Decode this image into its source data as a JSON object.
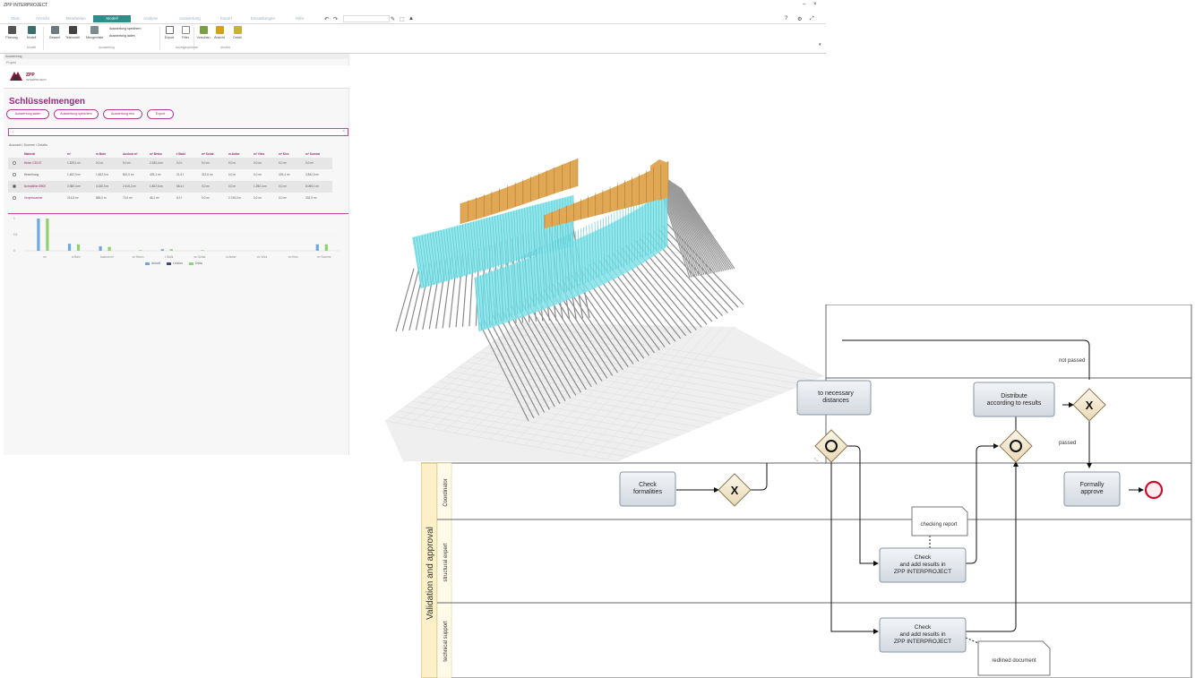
{
  "app": {
    "title": "ZPP INTERPROJECT",
    "window_controls": {
      "minimize": "–",
      "close": "×"
    },
    "tabs": [
      {
        "label": "Start",
        "active": false
      },
      {
        "label": "Ansicht",
        "active": false
      },
      {
        "label": "Bearbeiten",
        "active": false
      },
      {
        "label": "Modell",
        "active": true
      },
      {
        "label": "Analyse",
        "active": false
      },
      {
        "label": "Auswertung",
        "active": false
      },
      {
        "label": "Export",
        "active": false
      },
      {
        "label": "Einstellungen",
        "active": false
      },
      {
        "label": "Hilfe",
        "active": false
      }
    ],
    "ribbon": {
      "buttons": [
        {
          "label": "Planung",
          "color": "#555555"
        },
        {
          "label": "Modell",
          "color": "#3a6f6c"
        },
        {
          "label": "Gesamt",
          "color": "#6b7a7f"
        },
        {
          "label": "Teilmodell",
          "color": "#444444"
        },
        {
          "label": "Mengenliste",
          "color": "#7a8a8f"
        },
        {
          "label": "Export",
          "color": "#6c6c6c"
        },
        {
          "label": "Filter",
          "color": "#888888"
        },
        {
          "label": "Vorschau",
          "color": "#7aa046"
        },
        {
          "label": "Ansicht",
          "color": "#d4a117"
        },
        {
          "label": "Detail",
          "color": "#c9b23a"
        }
      ],
      "wide_items": [
        "Auswertung speichern",
        "Auswertung laden"
      ],
      "groups": [
        "Modell",
        "Auswertung",
        "Anzeigeoptionen",
        "Ansicht"
      ]
    },
    "panel": {
      "header": "Auswertung",
      "crumb": "Projekt",
      "logo_text": "ZPP",
      "logo_sub": "INTERPROJECT",
      "title": "Schlüsselmengen",
      "pills": [
        "Auswertung laden",
        "Auswertung speichern",
        "Auswertung neu",
        "Export"
      ],
      "filter_value": "",
      "table_caption": "Auswahl / Summe / Details",
      "table": {
        "headers": [
          "Material",
          "m³",
          "m Bohr",
          "Aushub m³",
          "m³ Beton",
          "t Stahl",
          "m² Schal.",
          "m Anker",
          "m² Vlies",
          "m³ Kies",
          "m³ Summe"
        ],
        "rows": [
          {
            "checked": false,
            "cells": [
              "Beton C30/37",
              "1.325,1 m³",
              "0,0 m",
              "0,0 m³",
              "2.180,4 m³",
              "0,0 t",
              "0,0 m²",
              "0,0 m",
              "0,0 m²",
              "0,0 m³",
              "0,0 m³"
            ]
          },
          {
            "checked": false,
            "cells": [
              "Bewehrung",
              "1.482,0 m³",
              "1.842,0 m",
              "842,0 m³",
              "425,1 m³",
              "21,3 t",
              "312,6 m²",
              "0,0 m",
              "0,0 m²",
              "325,4 m³",
              "3.842,6 m³"
            ]
          },
          {
            "checked": true,
            "cells": [
              "Bohrpfähle Ø900",
              "2.380,4 m³",
              "4.150,0 m",
              "2.416,2 m³",
              "1.822,5 m³",
              "65,4 t",
              "0,0 m²",
              "0,0 m",
              "1.250,4 m²",
              "0,0 m³",
              "8.065,1 m³"
            ]
          },
          {
            "checked": false,
            "cells": [
              "Verpressanker",
              "214,8 m³",
              "865,0 m",
              "72,0 m³",
              "46,1 m³",
              "8,2 t",
              "0,0 m²",
              "2.745,0 m",
              "0,0 m²",
              "0,0 m³",
              "332,9 m³"
            ]
          }
        ]
      },
      "chart_data": {
        "type": "bar",
        "categories": [
          "m³",
          "m Bohr",
          "Aushub m³",
          "m³ Beton",
          "t Stahl",
          "m² Schal.",
          "m Anker",
          "m² Vlies",
          "m³ Kies",
          "m³ Summe"
        ],
        "series": [
          {
            "name": "Aktuell",
            "color": "#6aa8e6",
            "values": [
              1.0,
              0.22,
              0.14,
              0.0,
              0.05,
              0.0,
              0.0,
              0.0,
              0.0,
              0.2
            ]
          },
          {
            "name": "Letztes",
            "color": "#3a4a7a",
            "values": [
              0.0,
              0.0,
              0.0,
              0.0,
              0.0,
              0.0,
              0.0,
              0.0,
              0.0,
              0.0
            ]
          },
          {
            "name": "Delta",
            "color": "#8bd36a",
            "values": [
              1.0,
              0.2,
              0.12,
              0.02,
              0.05,
              0.02,
              0.0,
              0.0,
              0.0,
              0.2
            ]
          }
        ],
        "ylim": [
          0,
          1.0
        ],
        "ytick_labels": [
          "1",
          "0,5",
          "0"
        ],
        "legend": "bottom-center"
      }
    }
  },
  "viewer3d": {
    "colors": {
      "shotcrete": "#7fe2e9",
      "wall_cap": "#e0a755",
      "anchors": "#8a8a8a",
      "ground": "#ececec"
    },
    "corner_mark": "⤡"
  },
  "bpmn": {
    "pool_label": "Validation and approval",
    "lanes": [
      "Coordinator",
      "structural expert",
      "technical support"
    ],
    "tasks": {
      "partial_top": "... to necessary ... distances",
      "distribute": "Distribute according to results",
      "check_formalities": "Check formalities",
      "formally_approve": "Formally approve",
      "check_structural": "Check and add results in ZPP INTERPROJECT",
      "check_technical": "Check and add results in ZPP INTERPROJECT"
    },
    "flow_labels": {
      "not_passed": "not passed",
      "passed": "passed"
    },
    "artifacts": {
      "checking_report": "checking report",
      "redlined_document": "redlined document"
    },
    "colors": {
      "task_fill": "#dfe4ea",
      "gateway_fill": "#f3e9d4",
      "end_event": "#c8102e"
    }
  }
}
